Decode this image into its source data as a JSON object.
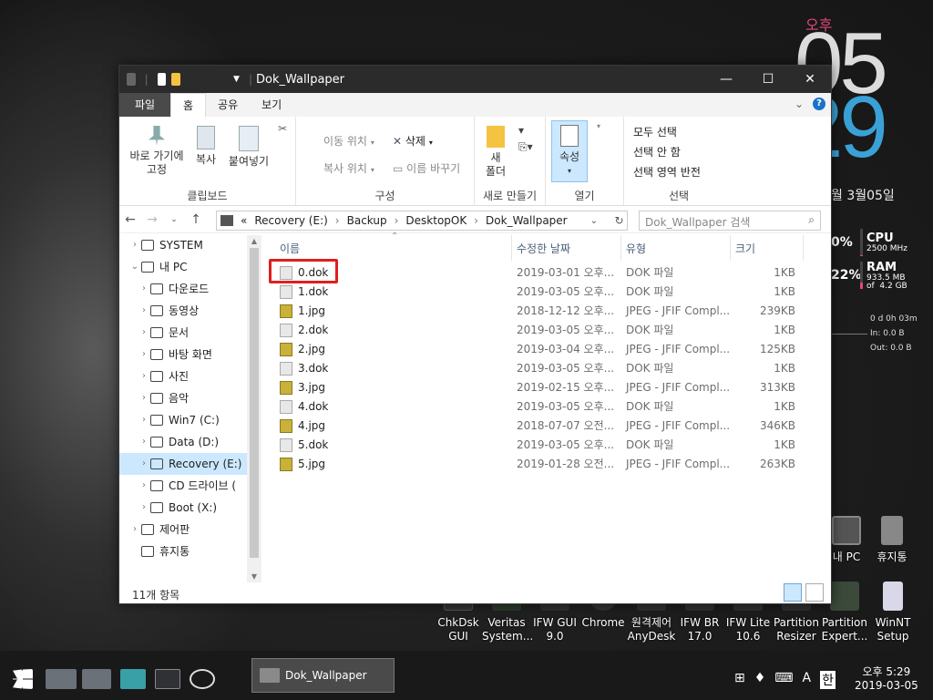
{
  "desktop": {
    "clock": {
      "ampm": "오후",
      "hour": "05",
      "minute": "29",
      "date": "월 3월05일"
    },
    "sysmon": [
      {
        "pct": "0%",
        "label": "CPU",
        "sub": "2500 MHz",
        "level": 0.05
      },
      {
        "pct": "22%",
        "label": "RAM",
        "sub": "933.5 MB\nof  4.2 GB",
        "level": 0.22
      }
    ],
    "net": {
      "uptime": "0 d 0h 03m",
      "in": "In: 0.0 B",
      "out": "Out: 0.0 B"
    },
    "icons": [
      {
        "id": "mypc",
        "label": "내 PC"
      },
      {
        "id": "recycle",
        "label": "휴지통"
      },
      {
        "id": "chkdsk",
        "label": "ChkDsk\nGUI"
      },
      {
        "id": "veritas",
        "label": "Veritas\nSystem..."
      },
      {
        "id": "ifwgui",
        "label": "IFW GUI\n9.0"
      },
      {
        "id": "chrome",
        "label": "Chrome"
      },
      {
        "id": "anydesk",
        "label": "원격제어\nAnyDesk"
      },
      {
        "id": "ifwbr",
        "label": "IFW BR\n17.0"
      },
      {
        "id": "ifwlite",
        "label": "IFW Lite\n10.6"
      },
      {
        "id": "partres",
        "label": "Partition\nResizer"
      },
      {
        "id": "partexp",
        "label": "Partition\nExpert..."
      },
      {
        "id": "winnt",
        "label": "WinNT\nSetup"
      }
    ]
  },
  "window": {
    "title": "Dok_Wallpaper",
    "tabs": [
      "파일",
      "홈",
      "공유",
      "보기"
    ],
    "ribbon": {
      "clipboard": {
        "pin": "바로 가기에\n고정",
        "copy": "복사",
        "paste": "붙여넣기",
        "group": "클립보드"
      },
      "organize": {
        "move": "이동 위치",
        "copyto": "복사 위치",
        "delete": "삭제",
        "rename": "이름 바꾸기",
        "group": "구성"
      },
      "new": {
        "folder": "새\n폴더",
        "group": "새로 만들기"
      },
      "open": {
        "props": "속성",
        "group": "열기"
      },
      "select": {
        "all": "모두 선택",
        "none": "선택 안 함",
        "invert": "선택 영역 반전",
        "group": "선택"
      }
    },
    "path": [
      "«",
      "Recovery (E:)",
      "›",
      "Backup",
      "›",
      "DesktopOK",
      "›",
      "Dok_Wallpaper"
    ],
    "search_placeholder": "Dok_Wallpaper 검색",
    "nav": [
      {
        "label": "SYSTEM",
        "indent": 0,
        "arrow": "›"
      },
      {
        "label": "내 PC",
        "indent": 0,
        "arrow": "⌄"
      },
      {
        "label": "다운로드",
        "indent": 1,
        "arrow": "›"
      },
      {
        "label": "동영상",
        "indent": 1,
        "arrow": "›"
      },
      {
        "label": "문서",
        "indent": 1,
        "arrow": "›"
      },
      {
        "label": "바탕 화면",
        "indent": 1,
        "arrow": "›"
      },
      {
        "label": "사진",
        "indent": 1,
        "arrow": "›"
      },
      {
        "label": "음악",
        "indent": 1,
        "arrow": "›"
      },
      {
        "label": "Win7 (C:)",
        "indent": 1,
        "arrow": "›"
      },
      {
        "label": "Data (D:)",
        "indent": 1,
        "arrow": "›"
      },
      {
        "label": "Recovery (E:)",
        "indent": 1,
        "arrow": "›",
        "selected": true
      },
      {
        "label": "CD 드라이브 (",
        "indent": 1,
        "arrow": "›"
      },
      {
        "label": "Boot (X:)",
        "indent": 1,
        "arrow": "›"
      },
      {
        "label": "제어판",
        "indent": 0,
        "arrow": "›"
      },
      {
        "label": "휴지통",
        "indent": 0,
        "arrow": ""
      }
    ],
    "columns": {
      "name": "이름",
      "date": "수정한 날짜",
      "type": "유형",
      "size": "크기"
    },
    "files": [
      {
        "name": "0.dok",
        "date": "2019-03-01 오후...",
        "type": "DOK 파일",
        "size": "1KB",
        "kind": "dok"
      },
      {
        "name": "1.dok",
        "date": "2019-03-05 오후...",
        "type": "DOK 파일",
        "size": "1KB",
        "kind": "dok"
      },
      {
        "name": "1.jpg",
        "date": "2018-12-12 오후...",
        "type": "JPEG - JFIF Compl...",
        "size": "239KB",
        "kind": "jpg"
      },
      {
        "name": "2.dok",
        "date": "2019-03-05 오후...",
        "type": "DOK 파일",
        "size": "1KB",
        "kind": "dok"
      },
      {
        "name": "2.jpg",
        "date": "2019-03-04 오후...",
        "type": "JPEG - JFIF Compl...",
        "size": "125KB",
        "kind": "jpg"
      },
      {
        "name": "3.dok",
        "date": "2019-03-05 오후...",
        "type": "DOK 파일",
        "size": "1KB",
        "kind": "dok"
      },
      {
        "name": "3.jpg",
        "date": "2019-02-15 오후...",
        "type": "JPEG - JFIF Compl...",
        "size": "313KB",
        "kind": "jpg"
      },
      {
        "name": "4.dok",
        "date": "2019-03-05 오후...",
        "type": "DOK 파일",
        "size": "1KB",
        "kind": "dok"
      },
      {
        "name": "4.jpg",
        "date": "2018-07-07 오전...",
        "type": "JPEG - JFIF Compl...",
        "size": "346KB",
        "kind": "jpg"
      },
      {
        "name": "5.dok",
        "date": "2019-03-05 오후...",
        "type": "DOK 파일",
        "size": "1KB",
        "kind": "dok"
      },
      {
        "name": "5.jpg",
        "date": "2019-01-28 오전...",
        "type": "JPEG - JFIF Compl...",
        "size": "263KB",
        "kind": "jpg"
      }
    ],
    "status": "11개 항목"
  },
  "taskbar": {
    "task": "Dok_Wallpaper",
    "tray": [
      "A",
      "한"
    ],
    "time": "오후 5:29",
    "date": "2019-03-05"
  }
}
